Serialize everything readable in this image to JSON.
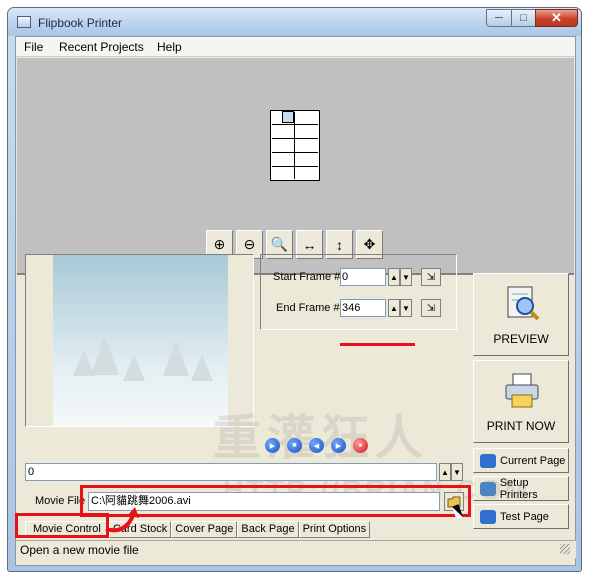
{
  "window": {
    "title": "Flipbook Printer",
    "controls": {
      "minimize": "─",
      "maximize": "□",
      "close": "✕"
    }
  },
  "menu": [
    "File",
    "Recent Projects",
    "Help"
  ],
  "zoom_toolbar": {
    "buttons": [
      {
        "name": "zoom-in",
        "glyph": "⊕"
      },
      {
        "name": "zoom-out",
        "glyph": "⊖"
      },
      {
        "name": "zoom-100",
        "glyph": "🔍"
      },
      {
        "name": "fit-width",
        "glyph": "↔"
      },
      {
        "name": "fit-height",
        "glyph": "↕"
      },
      {
        "name": "fit-page",
        "glyph": "✥"
      }
    ]
  },
  "frames": {
    "start_label": "Start Frame #",
    "start_value": "0",
    "end_label": "End Frame #",
    "end_value": "346"
  },
  "scrub_value": "0",
  "movie": {
    "label": "Movie File",
    "path": "C:\\阿貓跳舞2006.avi"
  },
  "tabs": [
    "Movie Control",
    "Card Stock",
    "Cover Page",
    "Back Page",
    "Print Options"
  ],
  "actions": {
    "preview": "PREVIEW",
    "print_now": "PRINT NOW",
    "current_page": "Current Page",
    "setup_printers": "Setup Printers",
    "test_page": "Test Page"
  },
  "status": "Open a new movie file",
  "watermark": {
    "line1": "重灌狂人",
    "line2": "HTTP://BRIAN.COM"
  },
  "colors": {
    "highlight_red": "#e8111b",
    "preview_bg": "#c0c0c0",
    "client_bg": "#ece9d8"
  }
}
